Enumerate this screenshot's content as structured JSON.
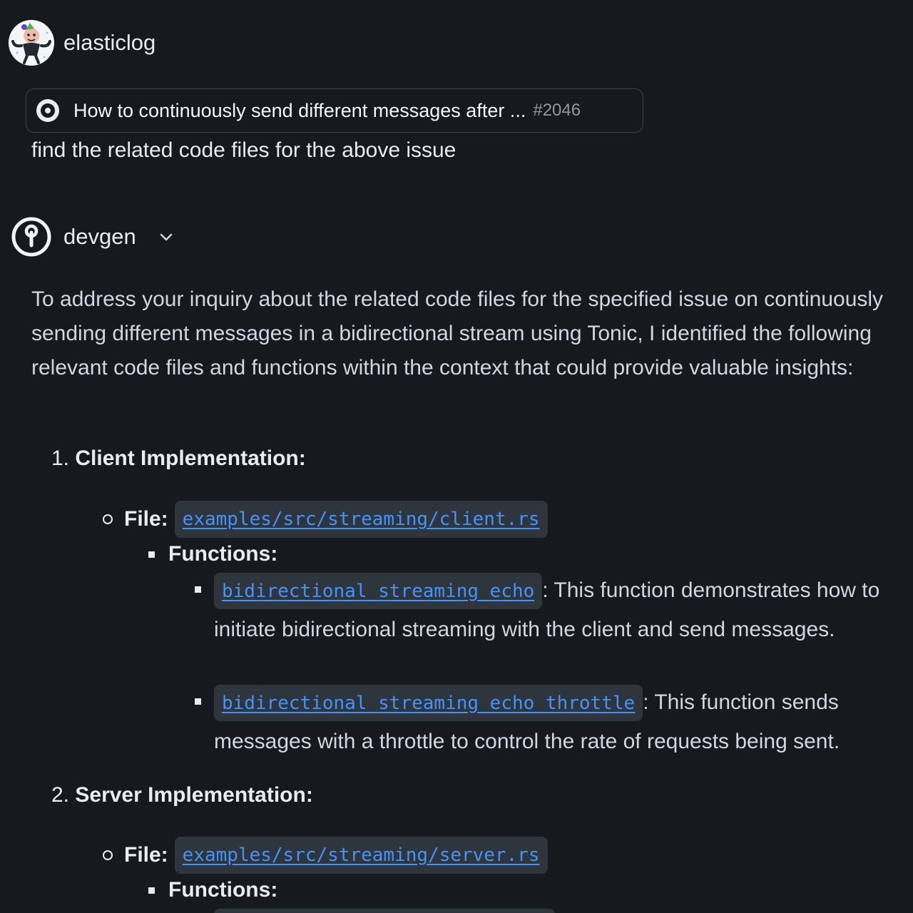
{
  "user": {
    "name": "elasticlog",
    "avatar": "user-avatar"
  },
  "issue": {
    "icon": "issue-open-icon",
    "title": "How to continuously send different messages after ...",
    "number": "#2046"
  },
  "prompt": "find the related code files for the above issue",
  "assistant": {
    "name": "devgen",
    "icon": "devgen-logo-icon",
    "toggle_icon": "chevron-down-icon"
  },
  "answer": {
    "intro": "To address your inquiry about the related code files for the specified issue on continuously sending different messages in a bidirectional stream using Tonic, I identified the following relevant code files and functions within the context that could provide valuable insights:",
    "sections": [
      {
        "index": "1.",
        "heading": "Client Implementation:",
        "file_label": "File:",
        "file": "examples/src/streaming/client.rs",
        "functions_label": "Functions:",
        "functions": [
          {
            "name": "bidirectional_streaming_echo",
            "description": ": This function demonstrates how to initiate bidirectional streaming with the client and send messages."
          },
          {
            "name": "bidirectional_streaming_echo_throttle",
            "description": ": This function sends messages with a throttle to control the rate of requests being sent."
          }
        ]
      },
      {
        "index": "2.",
        "heading": "Server Implementation:",
        "file_label": "File:",
        "file": "examples/src/streaming/server.rs",
        "functions_label": "Functions:"
      }
    ]
  },
  "colors": {
    "background": "#16191d",
    "text": "#e6edf3",
    "link": "#4493f8",
    "code_background": "#2f353d",
    "border": "#3d444d",
    "muted": "#9198a1"
  }
}
